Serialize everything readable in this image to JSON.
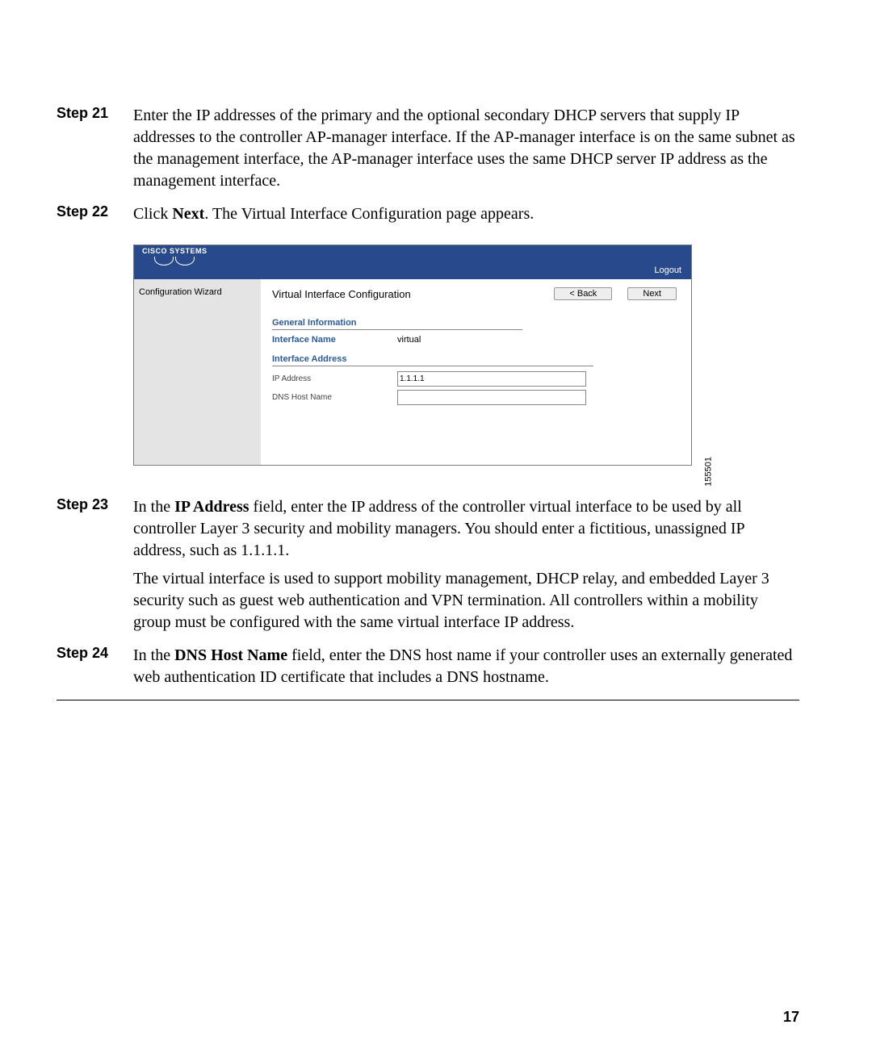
{
  "steps": {
    "s21": {
      "label": "Step 21",
      "text": "Enter the IP addresses of the primary and the optional secondary DHCP servers that supply IP addresses to the controller AP-manager interface. If the AP-manager interface is on the same subnet as the management interface, the AP-manager interface uses the same DHCP server IP address as the management interface."
    },
    "s22": {
      "label": "Step 22",
      "pre": "Click ",
      "bold": "Next",
      "post": ". The Virtual Interface Configuration page appears."
    },
    "s23": {
      "label": "Step 23",
      "p1_pre": "In the ",
      "p1_bold": "IP Address",
      "p1_post": " field, enter the IP address of the controller virtual interface to be used by all controller Layer 3 security and mobility managers. You should enter a fictitious, unassigned IP address, such as 1.1.1.1.",
      "p2": "The virtual interface is used to support mobility management, DHCP relay, and embedded Layer 3 security such as guest web authentication and VPN termination. All controllers within a mobility group must be configured with the same virtual interface IP address."
    },
    "s24": {
      "label": "Step 24",
      "pre": "In the ",
      "bold": "DNS Host Name",
      "post": " field, enter the DNS host name if your controller uses an externally generated web authentication ID certificate that includes a DNS hostname."
    }
  },
  "wizard": {
    "logo_text": "CISCO SYSTEMS",
    "logout": "Logout",
    "sidebar_title": "Configuration Wizard",
    "page_title": "Virtual Interface Configuration",
    "back_btn": "< Back",
    "next_btn": "Next",
    "section1": "General Information",
    "iface_name_label": "Interface Name",
    "iface_name_value": "virtual",
    "section2": "Interface Address",
    "ip_label": "IP Address",
    "ip_value": "1.1.1.1",
    "dns_label": "DNS Host Name",
    "dns_value": ""
  },
  "figure_id": "155501",
  "page_number": "17"
}
